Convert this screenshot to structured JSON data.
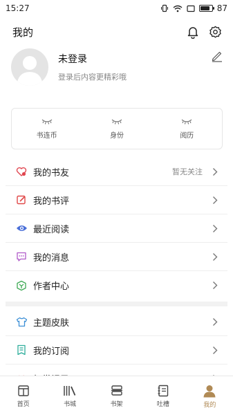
{
  "status_bar": {
    "time": "15:27",
    "battery": "87",
    "battery_level": 0.87
  },
  "header": {
    "title": "我的"
  },
  "profile": {
    "name": "未登录",
    "subtitle": "登录后内容更精彩哦"
  },
  "stats": [
    {
      "label": "书连币"
    },
    {
      "label": "身份"
    },
    {
      "label": "阅历"
    }
  ],
  "menu_a": [
    {
      "label": "我的书友",
      "extra": "暂无关注",
      "icon": "heart-users-icon",
      "color": "#e0454f"
    },
    {
      "label": "我的书评",
      "icon": "edit-note-icon",
      "color": "#e04848"
    },
    {
      "label": "最近阅读",
      "icon": "eye-icon",
      "color": "#4a6fd8"
    },
    {
      "label": "我的消息",
      "icon": "chat-bubble-icon",
      "color": "#b05ac9"
    },
    {
      "label": "作者中心",
      "icon": "cube-icon",
      "color": "#3faa55"
    }
  ],
  "menu_b": [
    {
      "label": "主题皮肤",
      "icon": "tshirt-icon",
      "color": "#3c8fd6"
    },
    {
      "label": "我的订阅",
      "icon": "bookmark-list-icon",
      "color": "#2fae9c"
    },
    {
      "label": "打赏记录",
      "icon": "gift-icon",
      "color": "#e05050"
    }
  ],
  "tabs": [
    {
      "label": "首页",
      "icon": "home-book-icon"
    },
    {
      "label": "书城",
      "icon": "library-icon"
    },
    {
      "label": "书架",
      "icon": "bookshelf-icon"
    },
    {
      "label": "吐槽",
      "icon": "notebook-icon"
    },
    {
      "label": "我的",
      "icon": "user-avatar-icon",
      "active": true
    }
  ],
  "colors": {
    "accent": "#b08a55",
    "divider": "#eeeeee",
    "section_gap": "#f2f2f2"
  }
}
